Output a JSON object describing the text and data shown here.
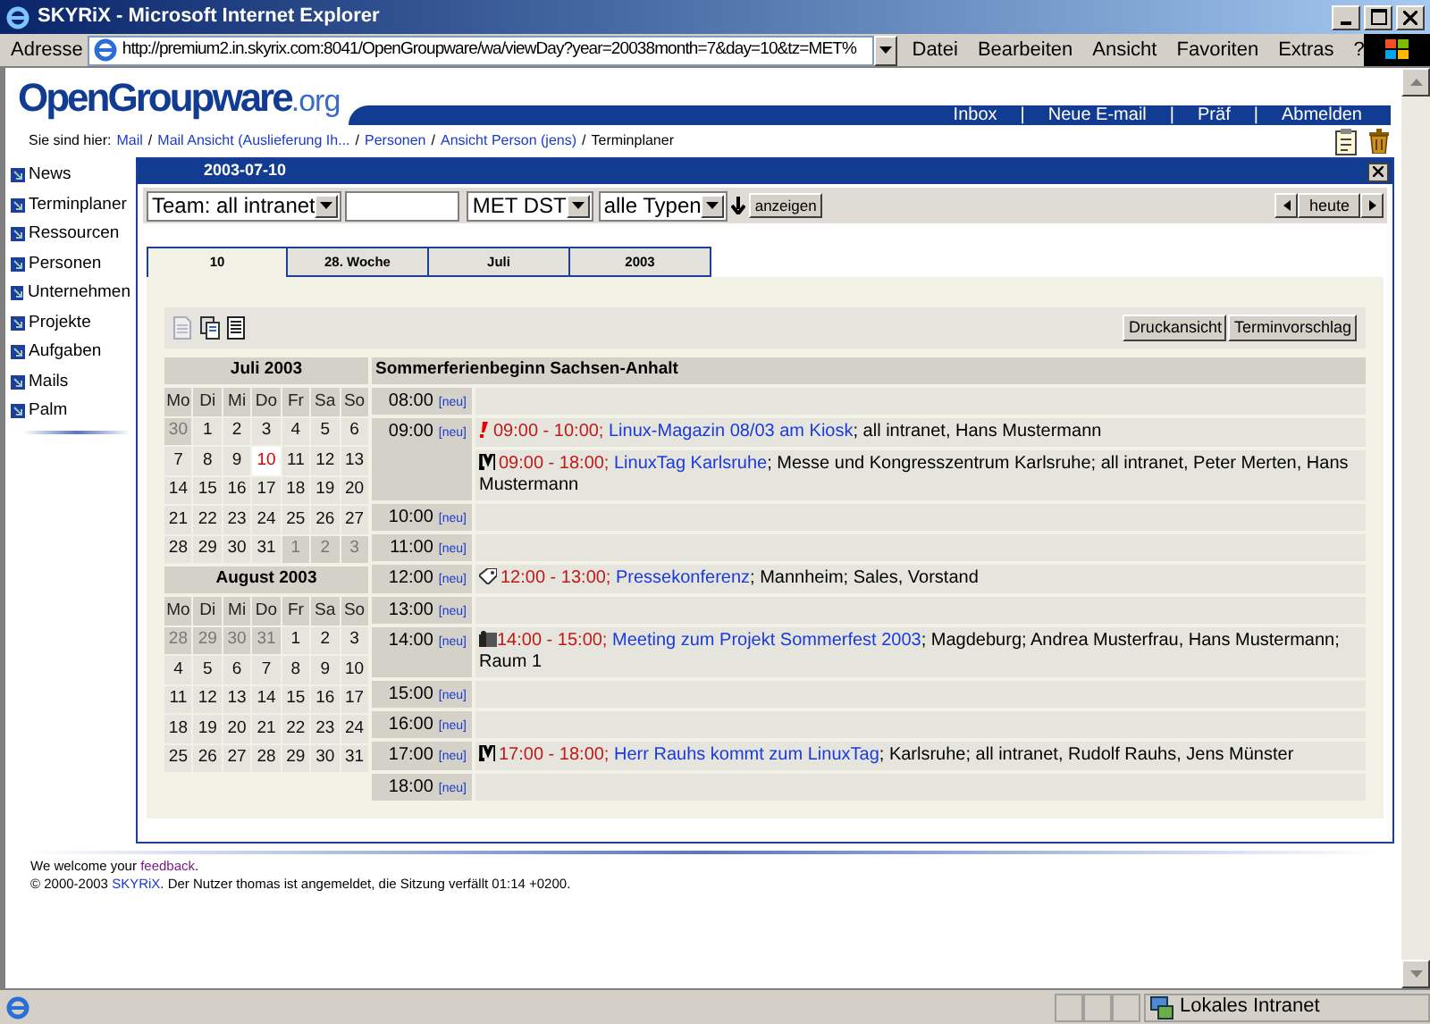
{
  "window": {
    "title": "SKYRiX - Microsoft Internet Explorer"
  },
  "address_bar": {
    "label": "Adresse",
    "url": "http://premium2.in.skyrix.com:8041/OpenGroupware/wa/viewDay?year=20038month=7&day=10&tz=MET%"
  },
  "menu": [
    "Datei",
    "Bearbeiten",
    "Ansicht",
    "Favoriten",
    "Extras",
    "?"
  ],
  "logo": {
    "text": "OpenGroupware",
    "suffix": ".org"
  },
  "top_nav": {
    "separator": "|",
    "items": [
      "Inbox",
      "Neue E-mail",
      "Präf",
      "Abmelden"
    ]
  },
  "breadcrumb": {
    "label": "Sie sind hier:",
    "separator": "/",
    "items": [
      {
        "text": "Mail",
        "link": true
      },
      {
        "text": "Mail Ansicht (Auslieferung Ih...",
        "link": true
      },
      {
        "text": "Personen",
        "link": true
      },
      {
        "text": "Ansicht Person (jens)",
        "link": true
      },
      {
        "text": "Terminplaner",
        "link": false
      }
    ]
  },
  "sidebar": {
    "items": [
      "News",
      "Terminplaner",
      "Ressourcen",
      "Personen",
      "Unternehmen",
      "Projekte",
      "Aufgaben",
      "Mails",
      "Palm"
    ]
  },
  "panel": {
    "title": "2003-07-10",
    "filters": {
      "team": "Team: all intranet",
      "timezone": "MET DST",
      "type": "alle Typen",
      "show_button": "anzeigen",
      "today_button": "heute"
    },
    "tabs": [
      {
        "label": "10",
        "selected": true
      },
      {
        "label": "28. Woche",
        "selected": false
      },
      {
        "label": "Juli",
        "selected": false
      },
      {
        "label": "2003",
        "selected": false
      }
    ],
    "buttons": [
      "Druckansicht",
      "Terminvorschlag"
    ],
    "mini_calendars": [
      {
        "title": "Juli 2003",
        "weekdays": [
          "Mo",
          "Di",
          "Mi",
          "Do",
          "Fr",
          "Sa",
          "So"
        ],
        "weeks": [
          [
            {
              "day": "30",
              "outside": true,
              "today": false
            },
            {
              "day": "1",
              "outside": false,
              "today": false
            },
            {
              "day": "2",
              "outside": false,
              "today": false
            },
            {
              "day": "3",
              "outside": false,
              "today": false
            },
            {
              "day": "4",
              "outside": false,
              "today": false
            },
            {
              "day": "5",
              "outside": false,
              "today": false
            },
            {
              "day": "6",
              "outside": false,
              "today": false
            }
          ],
          [
            {
              "day": "7",
              "outside": false,
              "today": false
            },
            {
              "day": "8",
              "outside": false,
              "today": false
            },
            {
              "day": "9",
              "outside": false,
              "today": false
            },
            {
              "day": "10",
              "outside": false,
              "today": true
            },
            {
              "day": "11",
              "outside": false,
              "today": false
            },
            {
              "day": "12",
              "outside": false,
              "today": false
            },
            {
              "day": "13",
              "outside": false,
              "today": false
            }
          ],
          [
            {
              "day": "14",
              "outside": false,
              "today": false
            },
            {
              "day": "15",
              "outside": false,
              "today": false
            },
            {
              "day": "16",
              "outside": false,
              "today": false
            },
            {
              "day": "17",
              "outside": false,
              "today": false
            },
            {
              "day": "18",
              "outside": false,
              "today": false
            },
            {
              "day": "19",
              "outside": false,
              "today": false
            },
            {
              "day": "20",
              "outside": false,
              "today": false
            }
          ],
          [
            {
              "day": "21",
              "outside": false,
              "today": false
            },
            {
              "day": "22",
              "outside": false,
              "today": false
            },
            {
              "day": "23",
              "outside": false,
              "today": false
            },
            {
              "day": "24",
              "outside": false,
              "today": false
            },
            {
              "day": "25",
              "outside": false,
              "today": false
            },
            {
              "day": "26",
              "outside": false,
              "today": false
            },
            {
              "day": "27",
              "outside": false,
              "today": false
            }
          ],
          [
            {
              "day": "28",
              "outside": false,
              "today": false
            },
            {
              "day": "29",
              "outside": false,
              "today": false
            },
            {
              "day": "30",
              "outside": false,
              "today": false
            },
            {
              "day": "31",
              "outside": false,
              "today": false
            },
            {
              "day": "1",
              "outside": true,
              "today": false
            },
            {
              "day": "2",
              "outside": true,
              "today": false
            },
            {
              "day": "3",
              "outside": true,
              "today": false
            }
          ]
        ]
      },
      {
        "title": "August 2003",
        "weekdays": [
          "Mo",
          "Di",
          "Mi",
          "Do",
          "Fr",
          "Sa",
          "So"
        ],
        "weeks": [
          [
            {
              "day": "28",
              "outside": true,
              "today": false
            },
            {
              "day": "29",
              "outside": true,
              "today": false
            },
            {
              "day": "30",
              "outside": true,
              "today": false
            },
            {
              "day": "31",
              "outside": true,
              "today": false
            },
            {
              "day": "1",
              "outside": false,
              "today": false
            },
            {
              "day": "2",
              "outside": false,
              "today": false
            },
            {
              "day": "3",
              "outside": false,
              "today": false
            }
          ],
          [
            {
              "day": "4",
              "outside": false,
              "today": false
            },
            {
              "day": "5",
              "outside": false,
              "today": false
            },
            {
              "day": "6",
              "outside": false,
              "today": false
            },
            {
              "day": "7",
              "outside": false,
              "today": false
            },
            {
              "day": "8",
              "outside": false,
              "today": false
            },
            {
              "day": "9",
              "outside": false,
              "today": false
            },
            {
              "day": "10",
              "outside": false,
              "today": false
            }
          ],
          [
            {
              "day": "11",
              "outside": false,
              "today": false
            },
            {
              "day": "12",
              "outside": false,
              "today": false
            },
            {
              "day": "13",
              "outside": false,
              "today": false
            },
            {
              "day": "14",
              "outside": false,
              "today": false
            },
            {
              "day": "15",
              "outside": false,
              "today": false
            },
            {
              "day": "16",
              "outside": false,
              "today": false
            },
            {
              "day": "17",
              "outside": false,
              "today": false
            }
          ],
          [
            {
              "day": "18",
              "outside": false,
              "today": false
            },
            {
              "day": "19",
              "outside": false,
              "today": false
            },
            {
              "day": "20",
              "outside": false,
              "today": false
            },
            {
              "day": "21",
              "outside": false,
              "today": false
            },
            {
              "day": "22",
              "outside": false,
              "today": false
            },
            {
              "day": "23",
              "outside": false,
              "today": false
            },
            {
              "day": "24",
              "outside": false,
              "today": false
            }
          ],
          [
            {
              "day": "25",
              "outside": false,
              "today": false
            },
            {
              "day": "26",
              "outside": false,
              "today": false
            },
            {
              "day": "27",
              "outside": false,
              "today": false
            },
            {
              "day": "28",
              "outside": false,
              "today": false
            },
            {
              "day": "29",
              "outside": false,
              "today": false
            },
            {
              "day": "30",
              "outside": false,
              "today": false
            },
            {
              "day": "31",
              "outside": false,
              "today": false
            }
          ]
        ]
      }
    ],
    "day_view": {
      "header": "Sommerferienbeginn Sachsen-Anhalt",
      "hours": [
        {
          "time": "08:00",
          "new_link": "[neu]"
        },
        {
          "time": "09:00",
          "new_link": "[neu]",
          "appointments": [
            {
              "kind": "important",
              "time": "09:00 - 10:00;",
              "title": "Linux-Magazin 08/03 am Kiosk",
              "details": "; all intranet, Hans Mustermann"
            },
            {
              "kind": "fair",
              "time": "09:00 - 18:00;",
              "title": "LinuxTag Karlsruhe",
              "details": "; Messe und Kongresszentrum Karlsruhe; all intranet, Peter Merten, Hans Mustermann"
            }
          ]
        },
        {
          "time": "10:00",
          "new_link": "[neu]"
        },
        {
          "time": "11:00",
          "new_link": "[neu]"
        },
        {
          "time": "12:00",
          "new_link": "[neu]",
          "appointments": [
            {
              "kind": "press",
              "time": "12:00 - 13:00;",
              "title": "Pressekonferenz",
              "details": "; Mannheim; Sales, Vorstand"
            }
          ]
        },
        {
          "time": "13:00",
          "new_link": "[neu]"
        },
        {
          "time": "14:00",
          "new_link": "[neu]",
          "appointments": [
            {
              "kind": "meeting",
              "time": "14:00 - 15:00;",
              "title": "Meeting zum Projekt Sommerfest 2003",
              "details": "; Magdeburg; Andrea Musterfrau, Hans Mustermann; Raum 1"
            }
          ]
        },
        {
          "time": "15:00",
          "new_link": "[neu]"
        },
        {
          "time": "16:00",
          "new_link": "[neu]"
        },
        {
          "time": "17:00",
          "new_link": "[neu]",
          "appointments": [
            {
              "kind": "fair",
              "time": "17:00 - 18:00;",
              "title": "Herr Rauhs kommt zum LinuxTag",
              "details": "; Karlsruhe; all intranet, Rudolf Rauhs, Jens Münster"
            }
          ]
        },
        {
          "time": "18:00",
          "new_link": "[neu]"
        }
      ]
    }
  },
  "footer": {
    "welcome": {
      "before": "We welcome your ",
      "link": "feedback",
      "after": "."
    },
    "copyright": {
      "before": "© 2000-2003 ",
      "link": "SKYRiX",
      "after": ". Der Nutzer thomas ist angemeldet, die Sitzung verfällt 01:14 +0200."
    }
  },
  "status_bar": {
    "zone": "Lokales Intranet"
  }
}
